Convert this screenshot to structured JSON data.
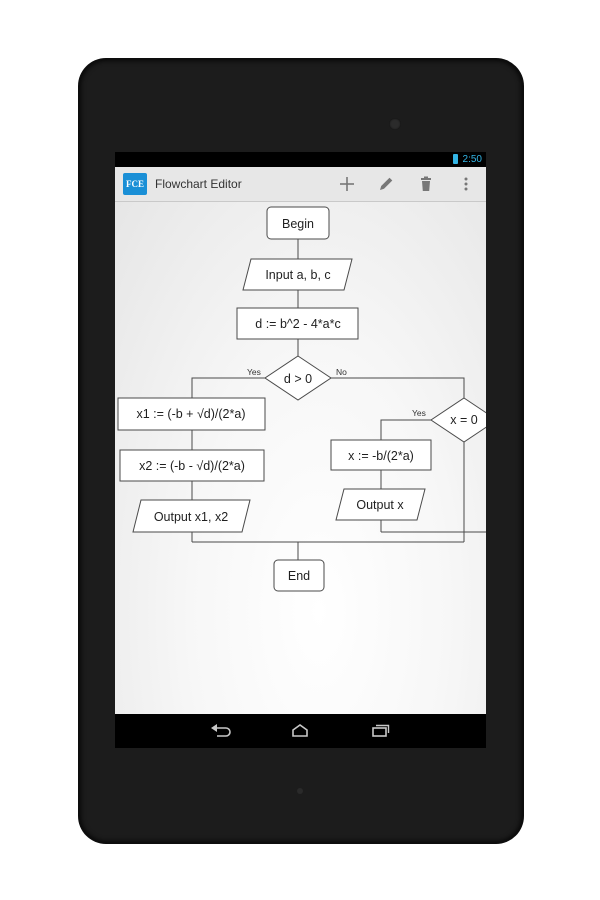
{
  "status_bar": {
    "time": "2:50"
  },
  "app": {
    "icon_text": "FCE",
    "title": "Flowchart Editor"
  },
  "actions": [
    {
      "icon": "plus-icon",
      "label": "Add"
    },
    {
      "icon": "pencil-icon",
      "label": "Edit"
    },
    {
      "icon": "trash-icon",
      "label": "Delete"
    },
    {
      "icon": "overflow-menu-icon",
      "label": "More"
    }
  ],
  "flowchart": {
    "begin": "Begin",
    "input": "Input a, b, c",
    "compute_d": "d := b^2 - 4*a*c",
    "decision_d": "d > 0",
    "yes_label": "Yes",
    "no_label": "No",
    "x1": "x1 := (-b + √d)/(2*a)",
    "x2": "x2 := (-b - √d)/(2*a)",
    "output_x1x2": "Output x1, x2",
    "decision_d0": "x = 0",
    "yes_label_2": "Yes",
    "x_single": "x := -b/(2*a)",
    "output_x": "Output x",
    "end": "End"
  },
  "nav": {
    "back": "back-icon",
    "home": "home-icon",
    "recents": "recents-icon"
  }
}
